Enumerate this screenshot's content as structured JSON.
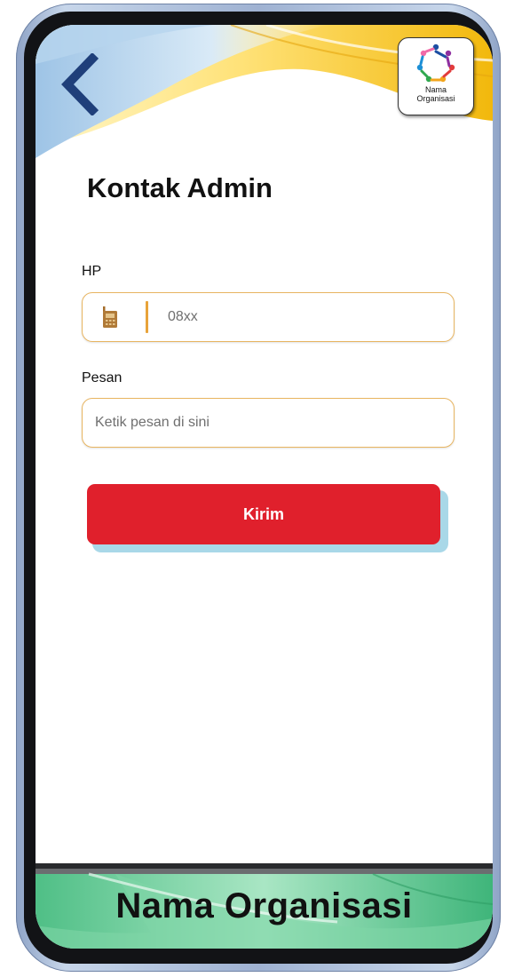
{
  "page": {
    "title": "Kontak Admin"
  },
  "header": {
    "logo_text": "Nama\nOrganisasi"
  },
  "form": {
    "hp": {
      "label": "HP",
      "value": "",
      "placeholder": "08xx"
    },
    "pesan": {
      "label": "Pesan",
      "value": "",
      "placeholder": "Ketik pesan di sini"
    },
    "submit_label": "Kirim"
  },
  "footer": {
    "title": "Nama Organisasi"
  },
  "icons": {
    "back": "chevron-left-icon",
    "phone": "mobile-phone-icon",
    "logo": "people-circle-logo-icon"
  },
  "colors": {
    "accent_button": "#e0202c",
    "input_border": "#e8b561",
    "back_arrow": "#1f3f7a",
    "footer_green": "#5cc88f",
    "header_gold": "#f4c21a"
  }
}
